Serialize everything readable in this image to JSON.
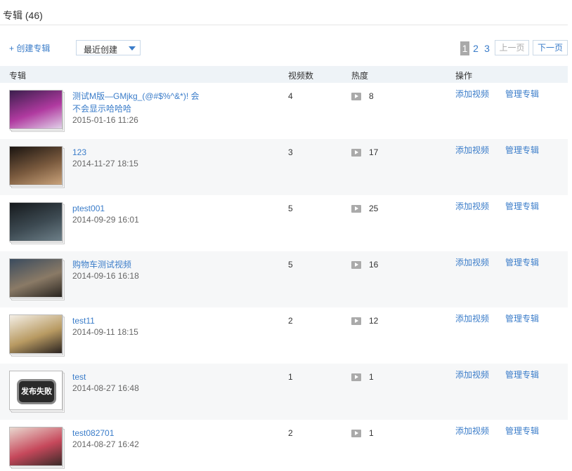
{
  "header": {
    "title": "专辑 (46)"
  },
  "toolbar": {
    "create_label": "+ 创建专辑",
    "sort_selected": "最近创建"
  },
  "pager": {
    "pages": [
      "1",
      "2",
      "3"
    ],
    "current_page": "1",
    "prev_label": "上一页",
    "next_label": "下一页"
  },
  "table": {
    "headers": {
      "album": "专辑",
      "video_count": "视频数",
      "heat": "热度",
      "actions": "操作"
    },
    "add_video_label": "添加视频",
    "manage_album_label": "管理专辑",
    "fail_badge_text": "发布失败",
    "rows": [
      {
        "title": "测试M版—GMjkg_(@#$%^&*)! 会不会显示哈哈哈",
        "date": "2015-01-16 11:26",
        "videos": "4",
        "heat": "8",
        "thumb": "purple-stage",
        "thumb_colors": [
          "#3b1e4d",
          "#b03aa0",
          "#e0d0e8"
        ]
      },
      {
        "title": "123",
        "date": "2014-11-27 18:15",
        "videos": "3",
        "heat": "17",
        "thumb": "man-portrait",
        "thumb_colors": [
          "#1a1410",
          "#7a5a3e",
          "#c9a27a"
        ]
      },
      {
        "title": "ptest001",
        "date": "2014-09-29 16:01",
        "videos": "5",
        "heat": "25",
        "thumb": "dark-scene",
        "thumb_colors": [
          "#15191c",
          "#3d4a52",
          "#6d7f88"
        ]
      },
      {
        "title": "购物车测试视频",
        "date": "2014-09-16 16:18",
        "videos": "5",
        "heat": "16",
        "thumb": "game-scene",
        "thumb_colors": [
          "#3a4b5e",
          "#8a7a66",
          "#2a2520"
        ]
      },
      {
        "title": "test11",
        "date": "2014-09-11 18:15",
        "videos": "2",
        "heat": "12",
        "thumb": "throne-portrait",
        "thumb_colors": [
          "#f4efe6",
          "#b89a62",
          "#2a2320"
        ]
      },
      {
        "title": "test",
        "date": "2014-08-27 16:48",
        "videos": "1",
        "heat": "1",
        "thumb": "publish-failed",
        "thumb_colors": [
          "#ffffff",
          "#2a2a2a",
          "#888888"
        ]
      },
      {
        "title": "test082701",
        "date": "2014-08-27 16:42",
        "videos": "2",
        "heat": "1",
        "thumb": "girl-photo",
        "thumb_colors": [
          "#e9d8cf",
          "#c6485b",
          "#3a2a28"
        ]
      }
    ]
  }
}
